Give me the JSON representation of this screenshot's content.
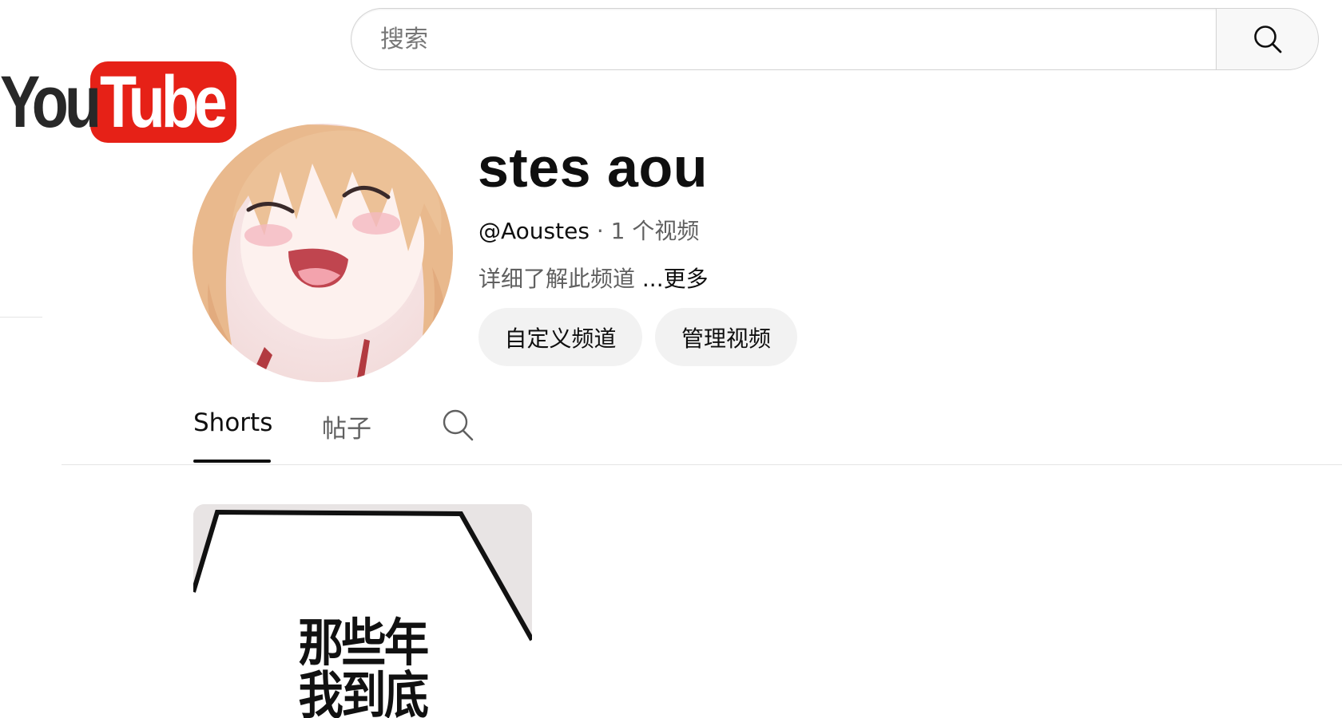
{
  "brand": {
    "logo_you": "You",
    "logo_tube": "Tube",
    "tube_color": "#e62117"
  },
  "search": {
    "placeholder": "搜索",
    "value": "",
    "icon": "search-icon"
  },
  "channel": {
    "name": "stes aou",
    "handle": "@Aoustes",
    "separator": " · ",
    "video_count": "1 个视频",
    "description": "详细了解此频道 ",
    "more_label": "...更多",
    "buttons": {
      "customize": "自定义频道",
      "manage": "管理视频"
    }
  },
  "tabs": [
    {
      "label": "Shorts",
      "active": true
    },
    {
      "label": "帖子",
      "active": false
    }
  ],
  "tab_search_icon": "search-icon",
  "shorts": [
    {
      "title": "那些年\n我到底"
    }
  ]
}
